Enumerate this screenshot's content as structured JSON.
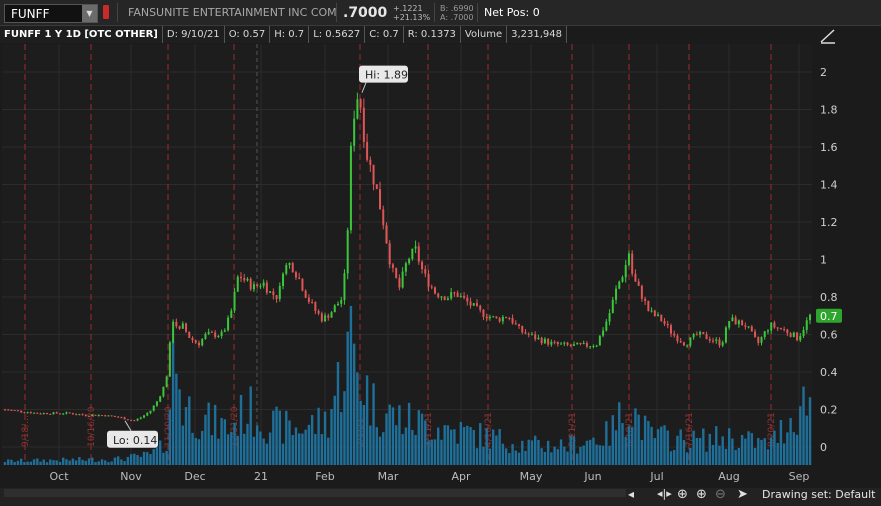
{
  "header": {
    "symbol": "FUNFF",
    "company": "FANSUNITE ENTERTAINMENT INC COM",
    "last": ".7000",
    "change": "+.1221",
    "change_pct": "+21.13%",
    "bid": "B: .6990",
    "ask": "A: .7000",
    "net_pos": "Net Pos: 0"
  },
  "infobar": {
    "title": "FUNFF 1 Y 1D [OTC OTHER]",
    "date": "D: 9/10/21",
    "open": "O: 0.57",
    "high": "H: 0.7",
    "low": "L: 0.5627",
    "close": "C: 0.7",
    "range": "R: 0.1373",
    "volume_label": "Volume",
    "volume": "3,231,948"
  },
  "chart_data": {
    "type": "candlestick",
    "y_ticks": [
      "2",
      "1.8",
      "1.6",
      "1.4",
      "1.2",
      "1",
      "0.8",
      "0.6",
      "0.4",
      "0.2",
      "0"
    ],
    "ylim": [
      -0.05,
      2.05
    ],
    "x_ticks": [
      "Oct",
      "Nov",
      "Dec",
      "21",
      "Feb",
      "Mar",
      "Apr",
      "May",
      "Jun",
      "Jul",
      "Aug",
      "Sep"
    ],
    "annotations": {
      "high": "Hi: 1.89",
      "low": "Lo: 0.14",
      "last": "0.7"
    },
    "event_labels": [
      "9/18/...",
      "10/16/20",
      "11/20/20",
      "12/31/20",
      "2/1/21",
      "3/11/21",
      "4/16/21",
      "5/21/21",
      "6/18/21",
      "7/16/21",
      "8/20/21"
    ],
    "close_path": [
      [
        0.0,
        0.2
      ],
      [
        0.02,
        0.19
      ],
      [
        0.04,
        0.18
      ],
      [
        0.06,
        0.18
      ],
      [
        0.08,
        0.18
      ],
      [
        0.1,
        0.17
      ],
      [
        0.12,
        0.17
      ],
      [
        0.14,
        0.16
      ],
      [
        0.15,
        0.15
      ],
      [
        0.16,
        0.14
      ],
      [
        0.17,
        0.16
      ],
      [
        0.18,
        0.19
      ],
      [
        0.19,
        0.25
      ],
      [
        0.2,
        0.35
      ],
      [
        0.205,
        0.55
      ],
      [
        0.21,
        0.72
      ],
      [
        0.215,
        0.6
      ],
      [
        0.22,
        0.65
      ],
      [
        0.23,
        0.58
      ],
      [
        0.24,
        0.55
      ],
      [
        0.25,
        0.6
      ],
      [
        0.27,
        0.6
      ],
      [
        0.28,
        0.7
      ],
      [
        0.29,
        0.92
      ],
      [
        0.3,
        0.88
      ],
      [
        0.31,
        0.85
      ],
      [
        0.32,
        0.88
      ],
      [
        0.33,
        0.82
      ],
      [
        0.34,
        0.8
      ],
      [
        0.345,
        0.95
      ],
      [
        0.355,
        0.98
      ],
      [
        0.365,
        0.9
      ],
      [
        0.375,
        0.8
      ],
      [
        0.385,
        0.73
      ],
      [
        0.395,
        0.68
      ],
      [
        0.405,
        0.72
      ],
      [
        0.42,
        0.8
      ],
      [
        0.425,
        1.1
      ],
      [
        0.43,
        1.6
      ],
      [
        0.435,
        1.85
      ],
      [
        0.44,
        1.89
      ],
      [
        0.445,
        1.7
      ],
      [
        0.45,
        1.55
      ],
      [
        0.46,
        1.4
      ],
      [
        0.47,
        1.2
      ],
      [
        0.48,
        0.95
      ],
      [
        0.49,
        0.85
      ],
      [
        0.5,
        1.0
      ],
      [
        0.51,
        1.05
      ],
      [
        0.52,
        0.92
      ],
      [
        0.535,
        0.82
      ],
      [
        0.55,
        0.8
      ],
      [
        0.56,
        0.82
      ],
      [
        0.575,
        0.77
      ],
      [
        0.59,
        0.72
      ],
      [
        0.61,
        0.68
      ],
      [
        0.625,
        0.7
      ],
      [
        0.64,
        0.62
      ],
      [
        0.66,
        0.58
      ],
      [
        0.68,
        0.55
      ],
      [
        0.7,
        0.54
      ],
      [
        0.72,
        0.54
      ],
      [
        0.735,
        0.55
      ],
      [
        0.75,
        0.7
      ],
      [
        0.76,
        0.85
      ],
      [
        0.77,
        0.95
      ],
      [
        0.775,
        1.04
      ],
      [
        0.78,
        0.9
      ],
      [
        0.79,
        0.82
      ],
      [
        0.8,
        0.72
      ],
      [
        0.815,
        0.68
      ],
      [
        0.83,
        0.6
      ],
      [
        0.845,
        0.55
      ],
      [
        0.86,
        0.6
      ],
      [
        0.875,
        0.58
      ],
      [
        0.89,
        0.55
      ],
      [
        0.9,
        0.68
      ],
      [
        0.92,
        0.65
      ],
      [
        0.935,
        0.55
      ],
      [
        0.95,
        0.65
      ],
      [
        0.97,
        0.62
      ],
      [
        0.985,
        0.58
      ],
      [
        1.0,
        0.7
      ]
    ],
    "volume_profile": [
      [
        0.0,
        0.02
      ],
      [
        0.14,
        0.03
      ],
      [
        0.18,
        0.05
      ],
      [
        0.2,
        0.1
      ],
      [
        0.205,
        0.32
      ],
      [
        0.21,
        0.55
      ],
      [
        0.215,
        0.48
      ],
      [
        0.22,
        0.3
      ],
      [
        0.25,
        0.22
      ],
      [
        0.28,
        0.18
      ],
      [
        0.3,
        0.28
      ],
      [
        0.33,
        0.2
      ],
      [
        0.36,
        0.18
      ],
      [
        0.4,
        0.22
      ],
      [
        0.425,
        0.55
      ],
      [
        0.43,
        0.62
      ],
      [
        0.44,
        0.45
      ],
      [
        0.46,
        0.28
      ],
      [
        0.5,
        0.22
      ],
      [
        0.55,
        0.18
      ],
      [
        0.6,
        0.14
      ],
      [
        0.65,
        0.1
      ],
      [
        0.7,
        0.1
      ],
      [
        0.75,
        0.15
      ],
      [
        0.775,
        0.3
      ],
      [
        0.8,
        0.15
      ],
      [
        0.85,
        0.12
      ],
      [
        0.9,
        0.14
      ],
      [
        0.95,
        0.1
      ],
      [
        1.0,
        0.35
      ]
    ]
  },
  "bottom": {
    "drawing_set": "Drawing set: Default"
  },
  "colors": {
    "up": "#3cc63c",
    "down": "#e05555",
    "volume": "#1e6f99",
    "grid": "#2c2c2c",
    "event_line": "#9b2a2a"
  }
}
